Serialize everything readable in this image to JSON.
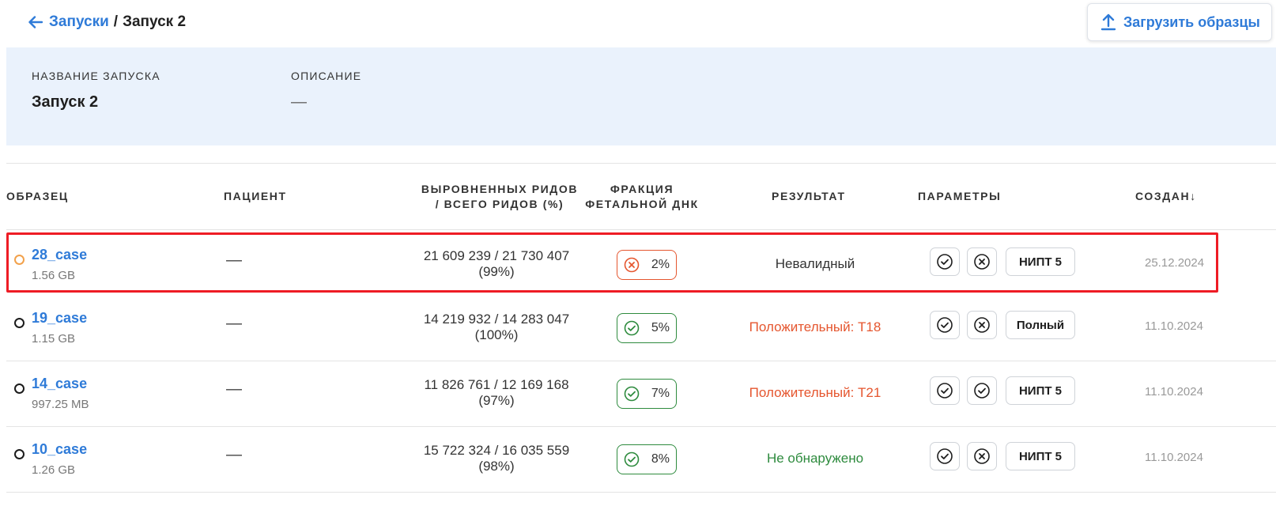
{
  "breadcrumb": {
    "parent": "Запуски",
    "separator": "/",
    "current": "Запуск 2"
  },
  "upload_button": {
    "label": "Загрузить образцы"
  },
  "run_info": {
    "name_label": "НАЗВАНИЕ ЗАПУСКА",
    "name_value": "Запуск 2",
    "description_label": "ОПИСАНИЕ",
    "description_value": "—"
  },
  "table": {
    "columns": {
      "sample": "ОБРАЗЕЦ",
      "patient": "ПАЦИЕНТ",
      "reads_line1": "ВЫРОВНЕННЫХ РИДОВ",
      "reads_line2": "/ ВСЕГО РИДОВ (%)",
      "fraction_line1": "ФРАКЦИЯ",
      "fraction_line2": "ФЕТАЛЬНОЙ ДНК",
      "result": "РЕЗУЛЬТАТ",
      "params": "ПАРАМЕТРЫ",
      "created": "СОЗДАН",
      "created_sort": "↓"
    },
    "rows": [
      {
        "status": "pending",
        "name": "28_case",
        "size": "1.56 GB",
        "patient": "—",
        "reads": "21 609 239 / 21 730 407",
        "reads_pct": "(99%)",
        "fraction": "2%",
        "fraction_ok": false,
        "result": "Невалидный",
        "result_color": "#333333",
        "param1": "check",
        "param2": "cross",
        "tag": "НИПТ 5",
        "created": "25.12.2024",
        "highlighted": true
      },
      {
        "status": "done",
        "name": "19_case",
        "size": "1.15 GB",
        "patient": "—",
        "reads": "14 219 932 / 14 283 047",
        "reads_pct": "(100%)",
        "fraction": "5%",
        "fraction_ok": true,
        "result": "Положительный: T18",
        "result_color": "#e5562f",
        "param1": "check",
        "param2": "cross",
        "tag": "Полный",
        "created": "11.10.2024",
        "highlighted": false
      },
      {
        "status": "done",
        "name": "14_case",
        "size": "997.25 MB",
        "patient": "—",
        "reads": "11 826 761 / 12 169 168",
        "reads_pct": "(97%)",
        "fraction": "7%",
        "fraction_ok": true,
        "result": "Положительный: T21",
        "result_color": "#e5562f",
        "param1": "check",
        "param2": "check",
        "tag": "НИПТ 5",
        "created": "11.10.2024",
        "highlighted": false
      },
      {
        "status": "done",
        "name": "10_case",
        "size": "1.26 GB",
        "patient": "—",
        "reads": "15 722 324 / 16 035 559",
        "reads_pct": "(98%)",
        "fraction": "8%",
        "fraction_ok": true,
        "result": "Не обнаружено",
        "result_color": "#2e8b3e",
        "param1": "check",
        "param2": "cross",
        "tag": "НИПТ 5",
        "created": "11.10.2024",
        "highlighted": false
      }
    ]
  },
  "colors": {
    "accent": "#2f7bd8",
    "ok": "#2e8b3e",
    "bad": "#e5562f",
    "highlight": "#ee1c25",
    "panel": "#eaf2fc"
  }
}
